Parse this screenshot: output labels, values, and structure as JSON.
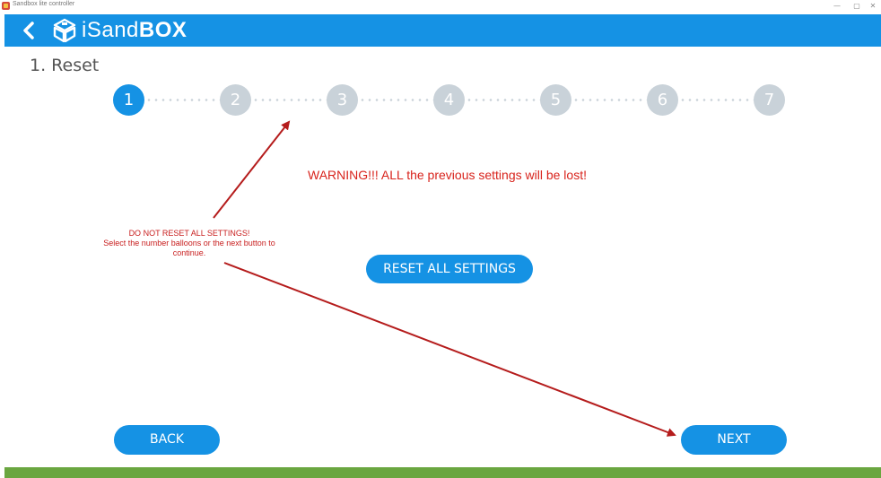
{
  "window": {
    "title": "Sandbox lite controller",
    "minimize_glyph": "—",
    "maximize_glyph": "▢",
    "close_glyph": "✕"
  },
  "header": {
    "back_icon": "chevron-left-icon",
    "logo_icon": "sandbox-cube-icon",
    "logo_light": "iSand",
    "logo_bold": "BOX",
    "background": "#1592e4"
  },
  "page": {
    "title": "1. Reset"
  },
  "stepper": {
    "steps": [
      "1",
      "2",
      "3",
      "4",
      "5",
      "6",
      "7"
    ],
    "active_index": 0,
    "active_color": "#1592e4",
    "inactive_color": "#c9d2d9"
  },
  "warning": "WARNING!!! ALL the previous settings will be lost!",
  "annotation": {
    "line1": "DO NOT RESET ALL SETTINGS!",
    "line2": "Select the number balloons or the next button to",
    "line3": "continue.",
    "color": "#c81e1e"
  },
  "buttons": {
    "reset": "RESET ALL SETTINGS",
    "back": "BACK",
    "next": "NEXT"
  },
  "footer": {
    "color": "#6aa640"
  }
}
